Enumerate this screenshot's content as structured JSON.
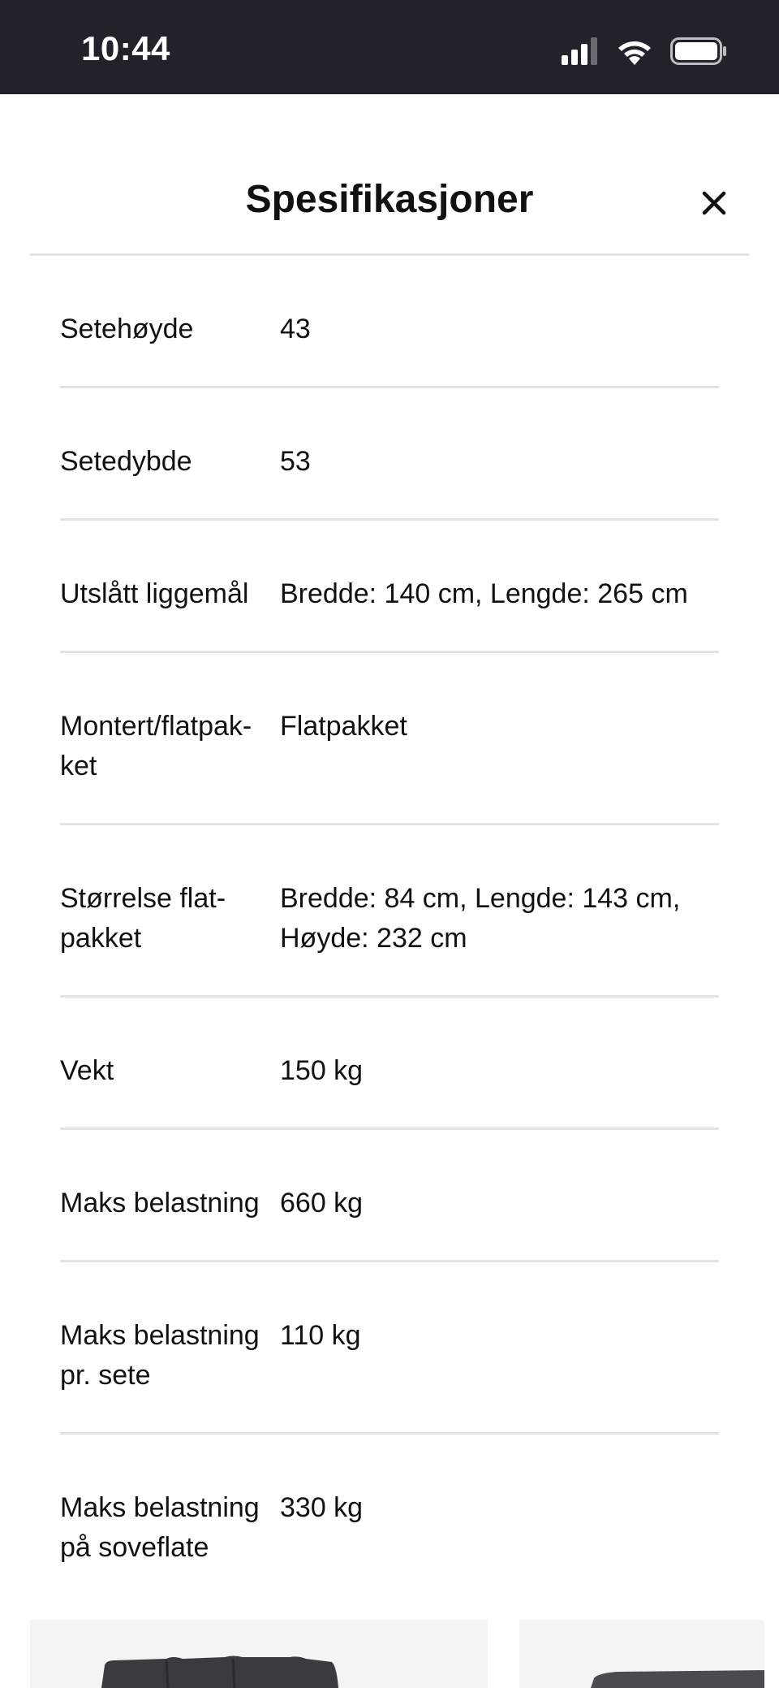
{
  "status_bar": {
    "time": "10:44",
    "icons": [
      "signal-icon",
      "wifi-icon",
      "battery-icon"
    ]
  },
  "sheet": {
    "title": "Spesifikasjoner",
    "close_icon": "close-icon"
  },
  "specs": [
    {
      "label": "Setehøyde",
      "value": "43"
    },
    {
      "label": "Setedybde",
      "value": "53"
    },
    {
      "label": "Utslått liggemål",
      "value": "Bredde: 140 cm, Lengde: 265 cm"
    },
    {
      "label": "Montert/flatpak-\nket",
      "value": "Flatpakket"
    },
    {
      "label": "Størrelse flat-\npakket",
      "value": "Bredde: 84 cm, Lengde: 143 cm,\nHøyde: 232 cm"
    },
    {
      "label": "Vekt",
      "value": "150 kg"
    },
    {
      "label": "Maks belastning",
      "value": "660 kg"
    },
    {
      "label": "Maks belastning\npr. sete",
      "value": "110 kg"
    },
    {
      "label": "Maks belastning\npå soveflate",
      "value": "330 kg"
    }
  ],
  "colors": {
    "status_bar_bg": "#22232a",
    "divider": "#e3e3e7",
    "card_bg": "#f4f4f5",
    "sofa": "#3a3b3f"
  }
}
